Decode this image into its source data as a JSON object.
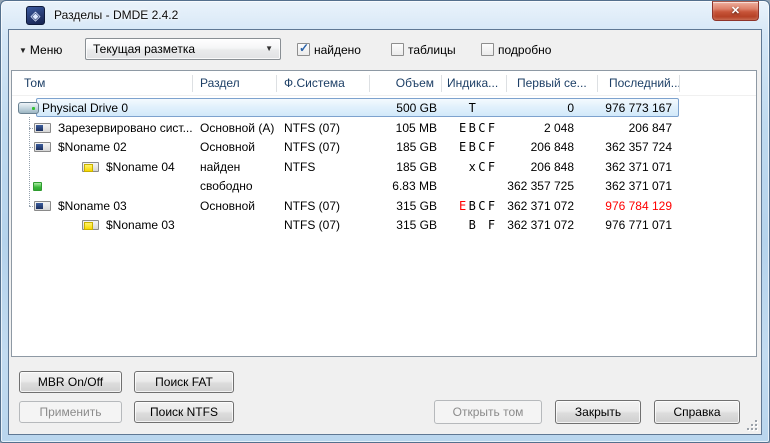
{
  "window": {
    "title": "Разделы - DMDE 2.4.2"
  },
  "icons": {
    "app_logo": "◈",
    "close": "✕",
    "menu_arrow": "▼",
    "combo_arrow": "▼",
    "check": "✓"
  },
  "toolbar": {
    "menu_label": "Меню",
    "layout_combo_value": "Текущая разметка",
    "checkboxes": [
      {
        "label": "найдено",
        "checked": true
      },
      {
        "label": "таблицы",
        "checked": false
      },
      {
        "label": "подробно",
        "checked": false
      }
    ]
  },
  "table": {
    "columns": [
      "Том",
      "Раздел",
      "Ф.Система",
      "Объем",
      "Индика...",
      "Первый се...",
      "Последний..."
    ],
    "rows": [
      {
        "name": "Physical Drive 0",
        "icon": "drive",
        "indent": 0,
        "selected": true,
        "stub": false,
        "partition": "",
        "fs": "",
        "size": "500 GB",
        "indicators": " T",
        "first": "0",
        "last": "976 773 167"
      },
      {
        "name": "Зарезервировано сист...",
        "icon": "partition",
        "indent": 1,
        "stub": true,
        "partition": "Основной (A)",
        "fs": "NTFS (07)",
        "size": "105 MB",
        "indicators": "EBCF",
        "first": "2 048",
        "last": "206 847"
      },
      {
        "name": "$Noname 02",
        "icon": "partition",
        "indent": 1,
        "stub": true,
        "partition": "Основной",
        "fs": "NTFS (07)",
        "size": "185 GB",
        "indicators": "EBCF",
        "first": "206 848",
        "last": "362 357 724"
      },
      {
        "name": "$Noname 04",
        "icon": "folder",
        "indent": 2,
        "stub": false,
        "partition": "найден",
        "fs": "NTFS",
        "size": "185 GB",
        "indicators": " xCF",
        "first": "206 848",
        "last": "362 371 071"
      },
      {
        "name": "",
        "icon": "free",
        "indent": 1,
        "stub": false,
        "partition": "свободно",
        "fs": "",
        "size": "6.83 MB",
        "indicators": "",
        "first": "362 357 725",
        "last": "362 371 071"
      },
      {
        "name": "$Noname 03",
        "icon": "partition",
        "indent": 1,
        "stub": true,
        "partition": "Основной",
        "fs": "NTFS (07)",
        "size": "315 GB",
        "indicators": "EBCF",
        "indicators_red": [
          0
        ],
        "first": "362 371 072",
        "last": "976 784 129",
        "last_red": true
      },
      {
        "name": "$Noname 03",
        "icon": "folder",
        "indent": 2,
        "stub": false,
        "partition": "",
        "fs": "NTFS (07)",
        "size": "315 GB",
        "indicators": " B F",
        "first": "362 371 072",
        "last": "976 771 071"
      }
    ]
  },
  "buttons": {
    "mbr": {
      "label": "MBR On/Off",
      "enabled": true
    },
    "search_fat": {
      "label": "Поиск FAT",
      "enabled": true
    },
    "apply": {
      "label": "Применить",
      "enabled": false
    },
    "search_ntfs": {
      "label": "Поиск NTFS",
      "enabled": true
    },
    "open_volume": {
      "label": "Открыть том",
      "enabled": false
    },
    "close": {
      "label": "Закрыть",
      "enabled": true
    },
    "help": {
      "label": "Справка",
      "enabled": true
    }
  },
  "colors": {
    "alert_red": "#ff0000",
    "selection_border": "#7da2ce",
    "header_text": "#1d3f66"
  }
}
